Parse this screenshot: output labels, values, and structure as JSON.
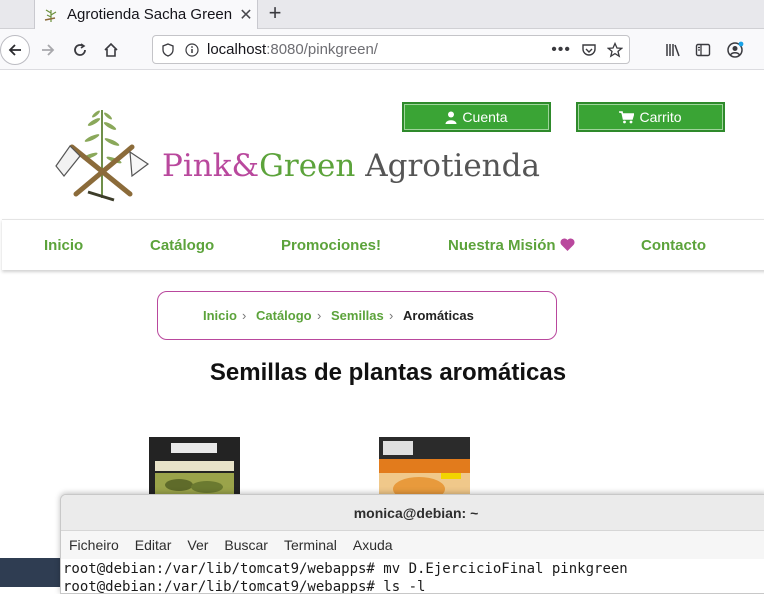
{
  "browser": {
    "tab_title": "Agrotienda Sacha Green",
    "url_host": "localhost",
    "url_rest": ":8080/pinkgreen/"
  },
  "header": {
    "brand_pink": "Pink&",
    "brand_green": "Green",
    "brand_rest": " Agrotienda",
    "cuenta_label": "Cuenta",
    "carrito_label": "Carrito"
  },
  "nav": {
    "items": [
      {
        "label": "Inicio"
      },
      {
        "label": "Catálogo"
      },
      {
        "label": "Promociones!"
      },
      {
        "label": "Nuestra Misión"
      },
      {
        "label": "Contacto"
      }
    ]
  },
  "breadcrumb": {
    "items": [
      "Inicio",
      "Catálogo",
      "Semillas",
      "Aromáticas"
    ],
    "separator": "›"
  },
  "page": {
    "title": "Semillas de plantas aromáticas"
  },
  "terminal": {
    "title": "monica@debian: ~",
    "menu": [
      "Ficheiro",
      "Editar",
      "Ver",
      "Buscar",
      "Terminal",
      "Axuda"
    ],
    "lines": [
      "root@debian:/var/lib/tomcat9/webapps# mv D.EjercicioFinal pinkgreen",
      "root@debian:/var/lib/tomcat9/webapps# ls -l"
    ]
  },
  "colors": {
    "brand_pink": "#b9489d",
    "brand_green": "#5ca33b",
    "button_green": "#3aa435"
  }
}
